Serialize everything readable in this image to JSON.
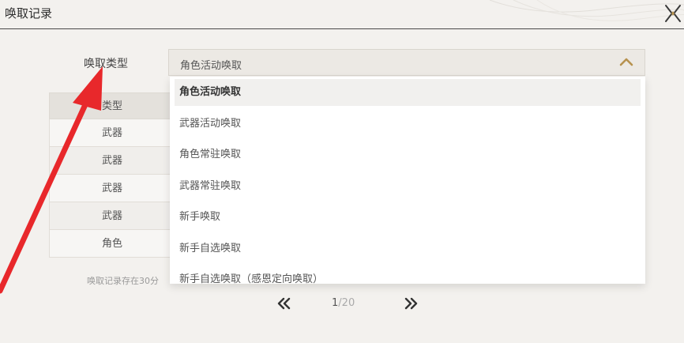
{
  "header": {
    "title": "唤取记录"
  },
  "filter": {
    "label": "唤取类型",
    "selected": "角色活动唤取"
  },
  "dropdown": {
    "options": [
      "角色活动唤取",
      "武器活动唤取",
      "角色常驻唤取",
      "武器常驻唤取",
      "新手唤取",
      "新手自选唤取",
      "新手自选唤取（感恩定向唤取）"
    ]
  },
  "table": {
    "header": "类型",
    "rows": [
      "武器",
      "武器",
      "武器",
      "武器",
      "角色"
    ]
  },
  "note": "唤取记录存在30分",
  "pagination": {
    "current": "1",
    "separator": "/",
    "total": "20"
  },
  "colors": {
    "accent_chevron": "#b7924f",
    "annotation_arrow": "#e8282b"
  }
}
